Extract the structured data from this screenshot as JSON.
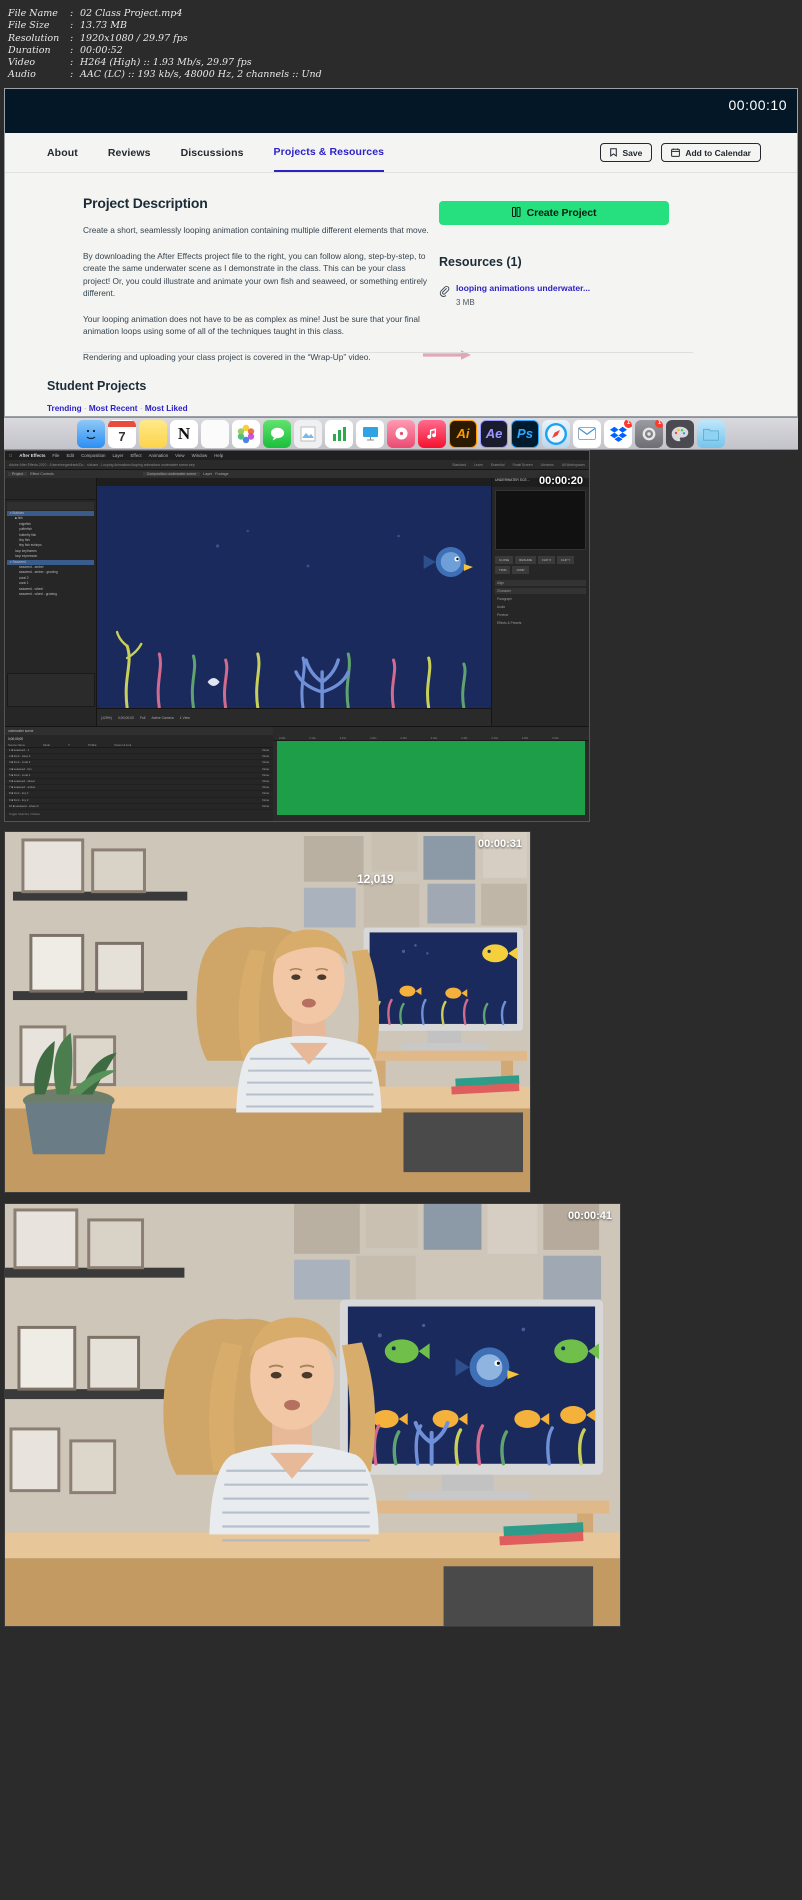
{
  "mediainfo": {
    "rows": [
      {
        "label": "File Name",
        "value": "02 Class Project.mp4"
      },
      {
        "label": "File Size",
        "value": "13.73 MB"
      },
      {
        "label": "Resolution",
        "value": "1920x1080 / 29.97 fps"
      },
      {
        "label": "Duration",
        "value": "00:00:52"
      },
      {
        "label": "Video",
        "value": "H264 (High) :: 1.93 Mb/s, 29.97 fps"
      },
      {
        "label": "Audio",
        "value": "AAC (LC) :: 193 kb/s, 48000 Hz, 2 channels :: Und"
      }
    ]
  },
  "shot1": {
    "timecode": "00:00:10",
    "tabs": [
      {
        "label": "About",
        "active": false
      },
      {
        "label": "Reviews",
        "active": false
      },
      {
        "label": "Discussions",
        "active": false
      },
      {
        "label": "Projects & Resources",
        "active": true
      }
    ],
    "save_label": "Save",
    "calendar_label": "Add to Calendar",
    "heading": "Project Description",
    "paragraphs": [
      "Create a short, seamlessly looping animation containing multiple different elements that move.",
      "By downloading the After Effects project file to the right, you can follow along, step-by-step, to create the same underwater scene as I demonstrate in the class. This can be your class project! Or, you could illustrate and animate your own fish and seaweed, or something entirely different.",
      "Your looping animation does not have to be as complex as mine! Just be sure that your final animation loops using some of all of the techniques taught in this class.",
      "Rendering and uploading your class project is covered in the “Wrap-Up” video."
    ],
    "create_project_label": "Create Project",
    "resources_heading": "Resources (1)",
    "resource": {
      "name": "looping animations underwater...",
      "size": "3 MB"
    },
    "student_projects_heading": "Student Projects",
    "filters": [
      "Trending",
      "Most Recent",
      "Most Liked"
    ],
    "accent_color": "#2d22c8",
    "green_color": "#26e07f"
  },
  "dock": {
    "items": [
      {
        "name": "finder-icon",
        "label": "",
        "color": "#2a8ff5"
      },
      {
        "name": "calendar-icon",
        "label": "7",
        "color": "#ffffff"
      },
      {
        "name": "notes-icon",
        "label": "",
        "color": "#ffd95e"
      },
      {
        "name": "notion-icon",
        "label": "N",
        "color": "#ffffff"
      },
      {
        "name": "reminders-icon",
        "label": "",
        "color": "#fafafa"
      },
      {
        "name": "photos-icon",
        "label": "",
        "color": "#fdfdfd"
      },
      {
        "name": "messages-icon",
        "label": "",
        "color": "#2fc44b"
      },
      {
        "name": "preview-icon",
        "label": "",
        "color": "#e9e9ec"
      },
      {
        "name": "numbers-icon",
        "label": "",
        "color": "#35b84f"
      },
      {
        "name": "keynote-icon",
        "label": "",
        "color": "#2fa3e3"
      },
      {
        "name": "itunes-icon",
        "label": "",
        "color": "#f05a7a"
      },
      {
        "name": "music-icon",
        "label": "",
        "color": "#fa2e55"
      },
      {
        "name": "illustrator-icon",
        "label": "Ai",
        "color": "#ff9a00"
      },
      {
        "name": "after-effects-icon",
        "label": "Ae",
        "color": "#9999ff"
      },
      {
        "name": "photoshop-icon",
        "label": "Ps",
        "color": "#31a8ff"
      },
      {
        "name": "safari-icon",
        "label": "",
        "color": "#1ea0f0"
      },
      {
        "name": "mail-icon",
        "label": "",
        "color": "#ffffff"
      },
      {
        "name": "dropbox-icon",
        "label": "",
        "color": "#0061fe",
        "badge": "1"
      },
      {
        "name": "system-preferences-icon",
        "label": "",
        "color": "#8e8e93",
        "badge": "1"
      },
      {
        "name": "palette-icon",
        "label": "",
        "color": "#5a5a5f"
      },
      {
        "name": "downloads-folder-icon",
        "label": "",
        "color": "#7fd3f7"
      }
    ]
  },
  "shot2": {
    "timecode": "00:00:20",
    "app_name": "After Effects",
    "menus": [
      "After Effects",
      "File",
      "Edit",
      "Composition",
      "Layer",
      "Effect",
      "Animation",
      "View",
      "Window",
      "Help"
    ],
    "title_bar": "Adobe After Effects 2020 - /Users/meganfrank/Do... s/share - Looping Animations/looping animations underwater scene.aep",
    "workspace_tabs": [
      "Standard",
      "Learn",
      "Essential",
      "Small Screen",
      "Libraries",
      "All Workspaces"
    ],
    "panel_tabs": [
      "Project",
      "Effect Controls",
      "Composition",
      "Layer",
      "Footage"
    ],
    "comp_tab_label": "Composition underwater scene",
    "timeline_tab_label": "underwater scene",
    "timeline_timecode": "0;00;00;00",
    "layer_column_headers": [
      "Source Name",
      "Mode",
      "T",
      "TrkMat",
      "Parent & Link"
    ],
    "right_panel_title": "UNDERWATER SCE...",
    "right_panel_buttons": [
      "CLOSE",
      "RESUME",
      "FLIP X",
      "FLIP Y",
      "TRIM",
      "JUMP"
    ],
    "right_panel_sections": [
      "Align",
      "Character",
      "Paragraph",
      "Audio",
      "Preview",
      "Effects & Presets"
    ],
    "magnification": "(129%)",
    "view_mode": "Active Camera",
    "view_count": "1 View",
    "resolution_label": "Full",
    "toggle_label": "Toggle Switches / Modes"
  },
  "shot3": {
    "timecode": "00:00:31",
    "monitor_counter": "12,019"
  },
  "shot4": {
    "timecode": "00:00:41"
  }
}
